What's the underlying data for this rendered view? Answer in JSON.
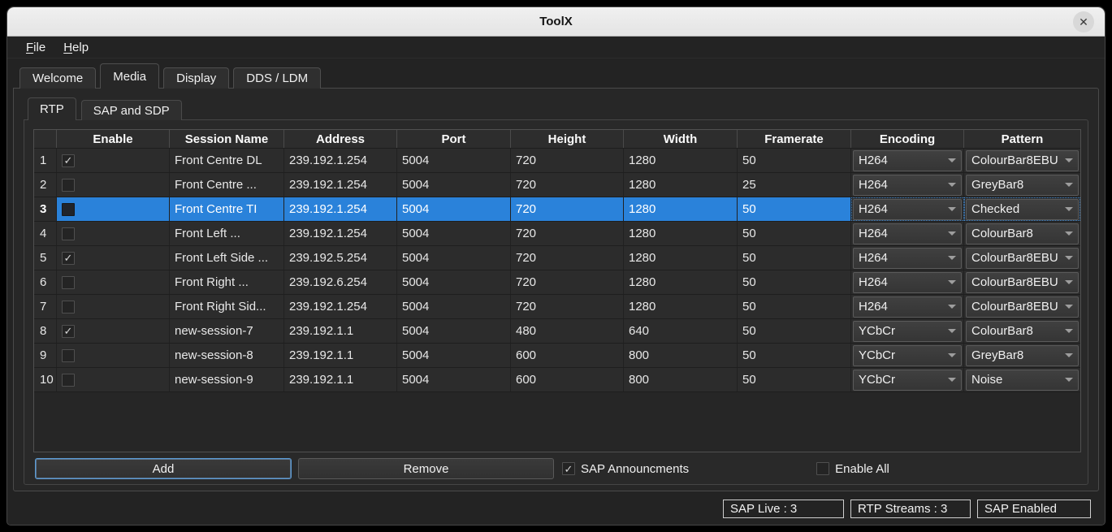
{
  "window": {
    "title": "ToolX",
    "close_icon": "✕"
  },
  "menu": {
    "items": [
      {
        "label": "File"
      },
      {
        "label": "Help"
      }
    ]
  },
  "tabs": [
    {
      "label": "Welcome",
      "active": false
    },
    {
      "label": "Media",
      "active": true
    },
    {
      "label": "Display",
      "active": false
    },
    {
      "label": "DDS / LDM",
      "active": false
    }
  ],
  "subtabs": [
    {
      "label": "RTP",
      "active": true
    },
    {
      "label": "SAP and SDP",
      "active": false
    }
  ],
  "table": {
    "columns": [
      "Enable",
      "Session Name",
      "Address",
      "Port",
      "Height",
      "Width",
      "Framerate",
      "Encoding",
      "Pattern"
    ],
    "rows": [
      {
        "num": "1",
        "enabled": true,
        "selected": false,
        "session": "Front Centre DL",
        "address": "239.192.1.254",
        "port": "5004",
        "height": "720",
        "width": "1280",
        "framerate": "50",
        "encoding": "H264",
        "pattern": "ColourBar8EBU"
      },
      {
        "num": "2",
        "enabled": false,
        "selected": false,
        "session": "Front Centre ...",
        "address": "239.192.1.254",
        "port": "5004",
        "height": "720",
        "width": "1280",
        "framerate": "25",
        "encoding": "H264",
        "pattern": "GreyBar8"
      },
      {
        "num": "3",
        "enabled": false,
        "selected": true,
        "session": "Front Centre TI",
        "address": "239.192.1.254",
        "port": "5004",
        "height": "720",
        "width": "1280",
        "framerate": "50",
        "encoding": "H264",
        "pattern": "Checked"
      },
      {
        "num": "4",
        "enabled": false,
        "selected": false,
        "session": "Front Left ...",
        "address": "239.192.1.254",
        "port": "5004",
        "height": "720",
        "width": "1280",
        "framerate": "50",
        "encoding": "H264",
        "pattern": "ColourBar8"
      },
      {
        "num": "5",
        "enabled": true,
        "selected": false,
        "session": "Front Left Side ...",
        "address": "239.192.5.254",
        "port": "5004",
        "height": "720",
        "width": "1280",
        "framerate": "50",
        "encoding": "H264",
        "pattern": "ColourBar8EBU"
      },
      {
        "num": "6",
        "enabled": false,
        "selected": false,
        "session": "Front Right ...",
        "address": "239.192.6.254",
        "port": "5004",
        "height": "720",
        "width": "1280",
        "framerate": "50",
        "encoding": "H264",
        "pattern": "ColourBar8EBU"
      },
      {
        "num": "7",
        "enabled": false,
        "selected": false,
        "session": "Front Right Sid...",
        "address": "239.192.1.254",
        "port": "5004",
        "height": "720",
        "width": "1280",
        "framerate": "50",
        "encoding": "H264",
        "pattern": "ColourBar8EBU"
      },
      {
        "num": "8",
        "enabled": true,
        "selected": false,
        "session": "new-session-7",
        "address": "239.192.1.1",
        "port": "5004",
        "height": "480",
        "width": "640",
        "framerate": "50",
        "encoding": "YCbCr",
        "pattern": "ColourBar8"
      },
      {
        "num": "9",
        "enabled": false,
        "selected": false,
        "session": "new-session-8",
        "address": "239.192.1.1",
        "port": "5004",
        "height": "600",
        "width": "800",
        "framerate": "50",
        "encoding": "YCbCr",
        "pattern": "GreyBar8"
      },
      {
        "num": "10",
        "enabled": false,
        "selected": false,
        "session": "new-session-9",
        "address": "239.192.1.1",
        "port": "5004",
        "height": "600",
        "width": "800",
        "framerate": "50",
        "encoding": "YCbCr",
        "pattern": "Noise"
      }
    ]
  },
  "controls": {
    "add_label": "Add",
    "remove_label": "Remove",
    "sap_announcements": {
      "label": "SAP Announcments",
      "checked": true
    },
    "enable_all": {
      "label": "Enable All",
      "checked": false
    }
  },
  "status_bar": {
    "items": [
      "SAP Live : 3",
      "RTP Streams : 3",
      "SAP Enabled"
    ]
  },
  "colors": {
    "highlight": "#2a82da",
    "titlebar": "#e9e9e9",
    "window_bg": "#232323",
    "panel_bg": "#272727"
  }
}
